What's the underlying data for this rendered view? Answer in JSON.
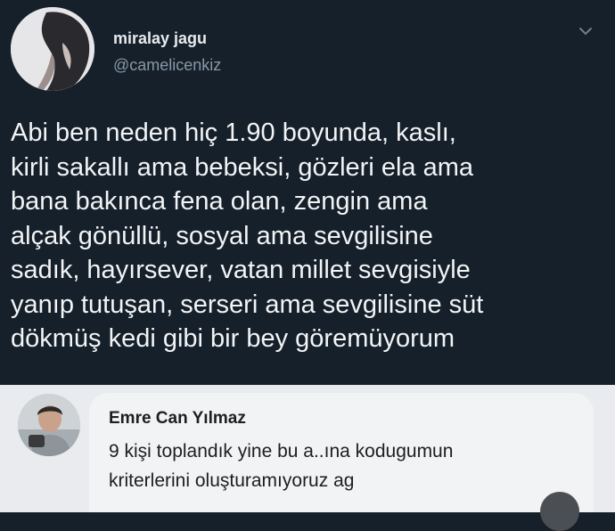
{
  "tweet": {
    "display_name": "miralay jagu",
    "handle": "@camelicenkiz",
    "text": "Abi ben neden hiç 1.90 boyunda, kaslı,\nkirli sakallı ama bebeksi, gözleri ela ama\nbana bakınca fena olan, zengin ama\nalçak gönüllü, sosyal ama sevgilisine\nsadık, hayırsever, vatan millet sevgisiyle\nyanıp tutuşan, serseri ama sevgilisine süt\ndökmüş kedi gibi bir bey göremüyorum",
    "menu_icon": "chevron-down-icon"
  },
  "comment": {
    "name": "Emre Can Yılmaz",
    "text": "9 kişi toplandık yine bu a..ına kodugumun\nkriterlerini oluşturamıyoruz ag"
  },
  "colors": {
    "tweet_bg": "#15202b",
    "comment_bg": "#f2f3f5",
    "handle": "#8899a6"
  }
}
